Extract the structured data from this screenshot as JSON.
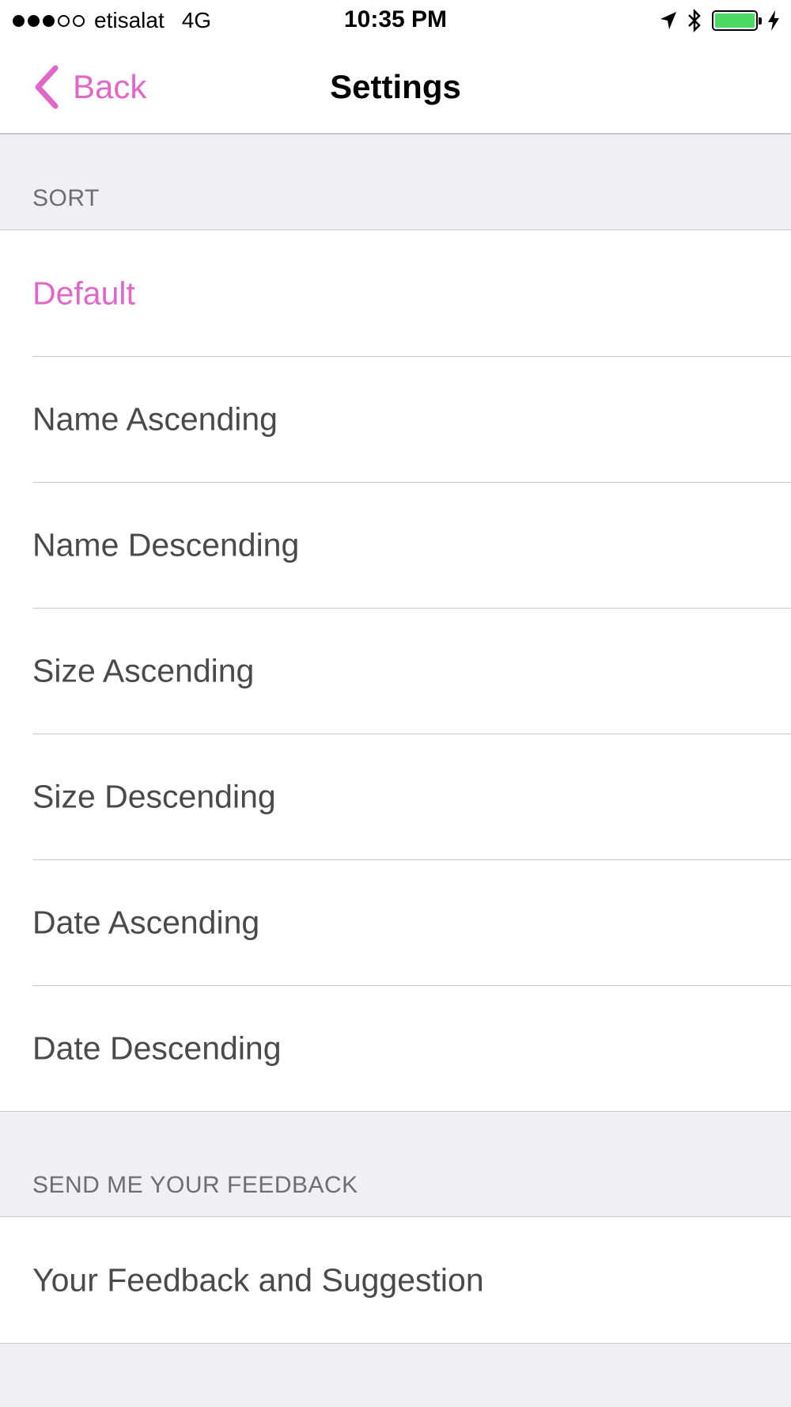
{
  "status_bar": {
    "carrier": "etisalat",
    "network": "4G",
    "time": "10:35 PM",
    "signal_bars": 3,
    "signal_total": 5,
    "battery_level": 1.0,
    "battery_color": "#4cd964",
    "icons": [
      "location-arrow-icon",
      "bluetooth-icon",
      "battery-icon",
      "charging-bolt-icon"
    ]
  },
  "nav": {
    "back_label": "Back",
    "title": "Settings",
    "accent_color": "#e066c8"
  },
  "sort_section": {
    "header": "SORT",
    "selected_index": 0,
    "items": [
      {
        "label": "Default"
      },
      {
        "label": "Name Ascending"
      },
      {
        "label": "Name Descending"
      },
      {
        "label": "Size Ascending"
      },
      {
        "label": "Size Descending"
      },
      {
        "label": "Date Ascending"
      },
      {
        "label": "Date Descending"
      }
    ]
  },
  "feedback_section": {
    "header": "SEND ME YOUR FEEDBACK",
    "items": [
      {
        "label": "Your Feedback and Suggestion"
      }
    ]
  }
}
